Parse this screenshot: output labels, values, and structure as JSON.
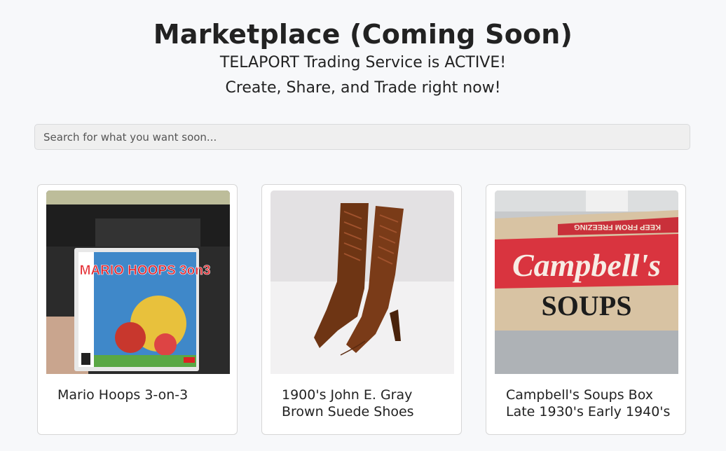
{
  "header": {
    "title": "Marketplace (Coming Soon)",
    "subtitle_line1": "TELAPORT Trading Service is ACTIVE!",
    "subtitle_line2": "Create, Share, and Trade right now!"
  },
  "search": {
    "placeholder": "Search for what you want soon..."
  },
  "listings": [
    {
      "title": "Mario Hoops 3-on-3",
      "image_text": "MARIO HOOPS 3on3"
    },
    {
      "title_line1": "1900's John E. Gray",
      "title_line2": "Brown Suede Shoes"
    },
    {
      "title_line1": "Campbell's Soups Box",
      "title_line2": "Late 1930's Early 1940's",
      "image_text_brand": "Campbell's",
      "image_text_product": "SOUPS",
      "image_text_banner": "KEEP FROM FREEZING"
    }
  ]
}
